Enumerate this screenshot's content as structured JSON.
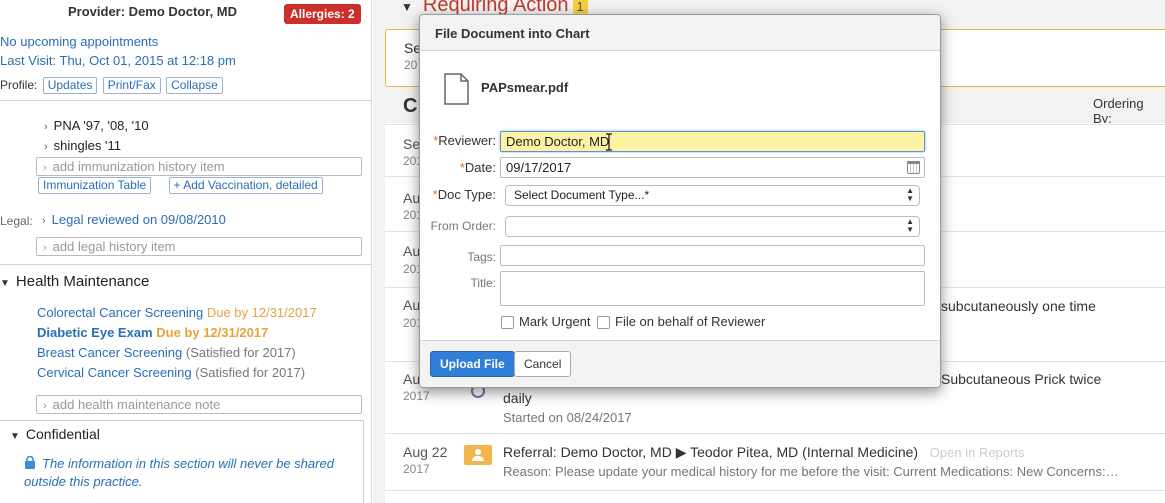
{
  "left": {
    "provider_label": "Provider: Demo Doctor, MD",
    "allergies_badge": "Allergies: 2",
    "no_appointments": "No upcoming appointments",
    "last_visit": "Last Visit: Thu, Oct 01, 2015 at 12:18 pm",
    "profile_label": "Profile:",
    "profile_buttons": [
      "Updates",
      "Print/Fax",
      "Collapse"
    ],
    "immunizations": [
      "PNA '97, '08, '10",
      "shingles '11"
    ],
    "add_immunization_placeholder": "add immunization history item",
    "immunization_table_btn": "Immunization Table",
    "add_vaccination_btn": "+ Add Vaccination, detailed",
    "legal_label": "Legal:",
    "legal_reviewed": "Legal reviewed on 09/08/2010",
    "add_legal_placeholder": "add legal history item",
    "health_maintenance_heading": "Health Maintenance",
    "hm_items": [
      {
        "name": "Colorectal Cancer Screening",
        "status": "Due by 12/31/2017"
      },
      {
        "name": "Diabetic Eye Exam",
        "status": "Due by 12/31/2017"
      },
      {
        "name": "Breast Cancer Screening",
        "status": "(Satisfied for 2017)"
      },
      {
        "name": "Cervical Cancer Screening",
        "status": "(Satisfied for 2017)"
      }
    ],
    "add_hm_placeholder": "add health maintenance note",
    "confidential_heading": "Confidential",
    "confidential_text": "The information in this section will never be shared outside this practice."
  },
  "right": {
    "requiring_action": "Requiring Action",
    "requiring_action_count": "1",
    "card_frag_1": "Se",
    "card_frag_2": "20",
    "c_heading": "C",
    "ordering_by": "Ordering By:",
    "rows": [
      {
        "month": "Se",
        "year": "201"
      },
      {
        "month": "Au",
        "year": "201"
      },
      {
        "month": "Au",
        "year": "201"
      },
      {
        "month": "Au",
        "year": "201",
        "text": "subcutaneously one time"
      },
      {
        "month": "Au",
        "year": "2017",
        "text": "Subcutaneous Prick twice",
        "text2": "daily",
        "sub": "Started on 08/24/2017"
      },
      {
        "month": "Aug 22",
        "year": "2017",
        "text": "Referral: Demo Doctor, MD ▶ Teodor Pitea, MD (Internal Medicine)",
        "link": "Open in Reports",
        "sub": "Reason: Please update your medical history for me before the visit: Current Medications: New Concerns:…"
      }
    ]
  },
  "modal": {
    "title": "File Document into Chart",
    "file_name": "PAPsmear.pdf",
    "reviewer_label": "Reviewer:",
    "reviewer_value": "Demo Doctor, MD",
    "date_label": "Date:",
    "date_value": "09/17/2017",
    "doc_type_label": "Doc Type:",
    "doc_type_value": "Select Document Type...*",
    "from_order_label": "From Order:",
    "from_order_value": "",
    "tags_label": "Tags:",
    "title_label": "Title:",
    "mark_urgent_label": "Mark Urgent",
    "file_behalf_label": "File on behalf of Reviewer",
    "upload_btn": "Upload File",
    "cancel_btn": "Cancel",
    "required_marker": "*"
  }
}
